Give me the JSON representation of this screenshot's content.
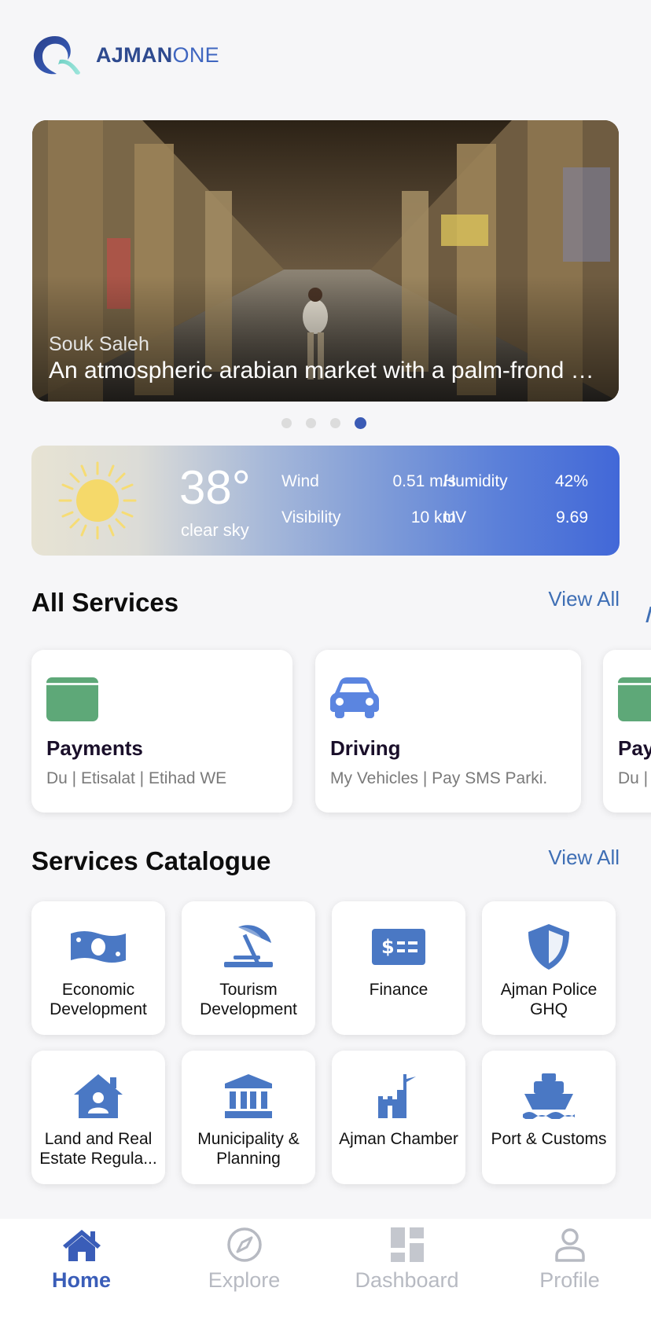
{
  "header": {
    "brand_a": "AJMAN",
    "brand_b": "ONE",
    "logo_icon": "ajman-one-logo-icon"
  },
  "carousel": {
    "subtitle": "Souk Saleh",
    "title": "An atmospheric arabian market with a palm-frond covered roof",
    "slide_count": 4,
    "active_slide": 4
  },
  "weather": {
    "temperature": "38°",
    "condition": "clear sky",
    "wind_label": "Wind",
    "wind_value": "0.51 m/s",
    "humidity_label": "Humidity",
    "humidity_value": "42%",
    "visibility_label": "Visibility",
    "visibility_value": "10 km",
    "uv_label": "UV",
    "uv_value": "9.69",
    "icon": "sun-icon"
  },
  "all_services": {
    "title": "All Services",
    "view_all": "View All",
    "cards": [
      {
        "name": "Payments",
        "desc": "Du | Etisalat | Etihad WE",
        "icon": "wallet-icon",
        "color": "#5ea878"
      },
      {
        "name": "Driving",
        "desc": "My Vehicles | Pay SMS Parki.",
        "icon": "car-icon",
        "color": "#5b85e0"
      },
      {
        "name": "Pay",
        "desc": "Du |",
        "icon": "wallet-icon",
        "color": "#5ea878"
      }
    ]
  },
  "catalogue": {
    "title": "Services Catalogue",
    "view_all": "View All",
    "items": [
      {
        "label": "Economic Development",
        "icon": "money-icon"
      },
      {
        "label": "Tourism Development",
        "icon": "beach-umbrella-icon"
      },
      {
        "label": "Finance",
        "icon": "dollar-bill-icon"
      },
      {
        "label": "Ajman Police GHQ",
        "icon": "shield-icon"
      },
      {
        "label": "Land and Real Estate Regula...",
        "icon": "house-user-icon"
      },
      {
        "label": "Municipality & Planning",
        "icon": "building-columns-icon"
      },
      {
        "label": "Ajman Chamber",
        "icon": "castle-icon"
      },
      {
        "label": "Port & Customs",
        "icon": "ship-icon"
      }
    ]
  },
  "nav": {
    "items": [
      {
        "label": "Home",
        "icon": "home-icon",
        "active": true
      },
      {
        "label": "Explore",
        "icon": "compass-icon",
        "active": false
      },
      {
        "label": "Dashboard",
        "icon": "dashboard-icon",
        "active": false
      },
      {
        "label": "Profile",
        "icon": "profile-icon",
        "active": false
      }
    ]
  },
  "colors": {
    "accent": "#3a5db8",
    "icon_blue": "#4a78c4",
    "link": "#3f6fb5"
  }
}
